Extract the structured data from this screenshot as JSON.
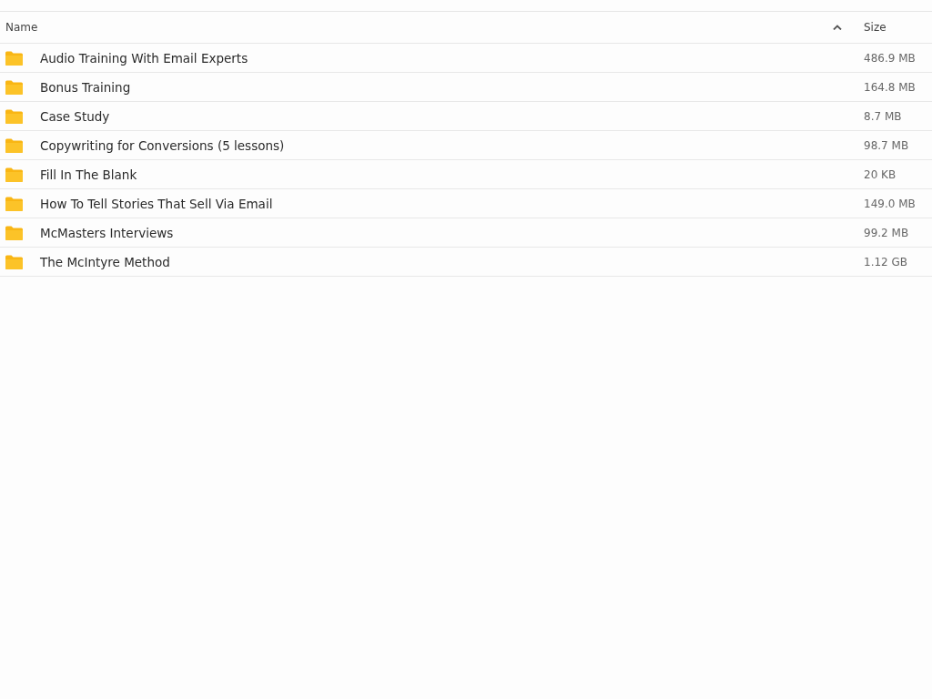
{
  "table": {
    "columns": [
      "Name",
      "Size"
    ],
    "rows": [
      {
        "name": "Audio Training With Email Experts",
        "size": "486.9 MB"
      },
      {
        "name": "Bonus Training",
        "size": "164.8 MB"
      },
      {
        "name": "Case Study",
        "size": "8.7 MB"
      },
      {
        "name": "Copywriting for Conversions (5 lessons)",
        "size": "98.7 MB"
      },
      {
        "name": "Fill In The Blank",
        "size": "20 KB"
      },
      {
        "name": "How To Tell Stories That Sell Via Email",
        "size": "149.0 MB"
      },
      {
        "name": "McMasters Interviews",
        "size": "99.2 MB"
      },
      {
        "name": "The McIntyre Method",
        "size": "1.12 GB"
      }
    ]
  }
}
